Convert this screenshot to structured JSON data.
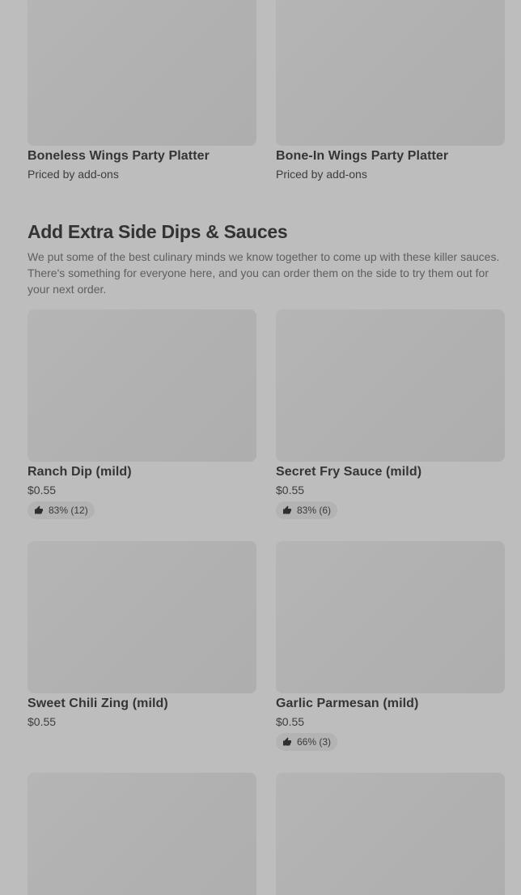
{
  "platters": [
    {
      "name": "Boneless Wings Party Platter",
      "price": "Priced by add-ons"
    },
    {
      "name": "Bone-In Wings Party Platter",
      "price": "Priced by add-ons"
    }
  ],
  "section": {
    "title": "Add Extra Side Dips & Sauces",
    "description": "We put some of the best culinary minds we know together to come up with these killer sauces. There's something for everyone here, and you can order them on the side to try them out for your next order."
  },
  "items": [
    {
      "name": "Ranch Dip (mild)",
      "price": "$0.55",
      "rating": "83% (12)"
    },
    {
      "name": "Secret Fry Sauce (mild)",
      "price": "$0.55",
      "rating": "83% (6)"
    },
    {
      "name": "Sweet Chili Zing (mild)",
      "price": "$0.55"
    },
    {
      "name": "Garlic Parmesan (mild)",
      "price": "$0.55",
      "rating": "66% (3)"
    }
  ],
  "icons": {
    "rating": "thumbs-up-icon"
  }
}
